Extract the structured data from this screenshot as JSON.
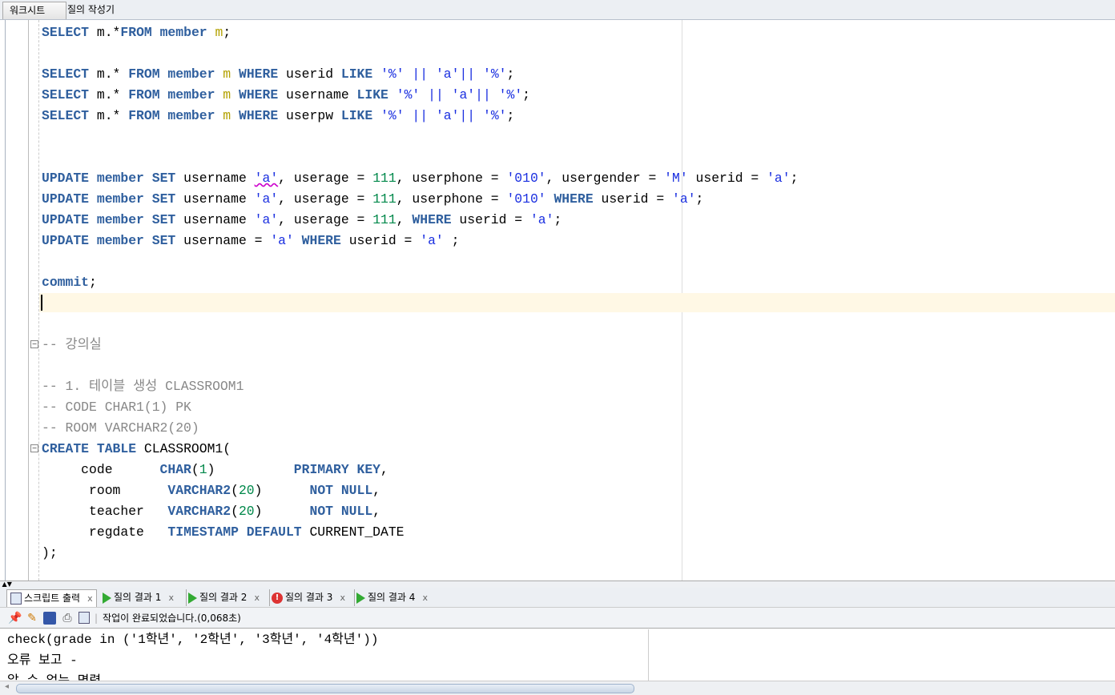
{
  "tabs": {
    "worksheet": "워크시트",
    "query_builder": "질의 작성기"
  },
  "editor": {
    "lines": [
      [
        [
          "SELECT",
          "kw"
        ],
        [
          " m.*",
          "tx"
        ],
        [
          "FROM",
          "kw"
        ],
        [
          " ",
          "tx"
        ],
        [
          "member",
          "kw"
        ],
        [
          " ",
          "tx"
        ],
        [
          "m",
          "al"
        ],
        [
          ";",
          "tx"
        ]
      ],
      [],
      [
        [
          "SELECT",
          "kw"
        ],
        [
          " m.* ",
          "tx"
        ],
        [
          "FROM",
          "kw"
        ],
        [
          " ",
          "tx"
        ],
        [
          "member",
          "kw"
        ],
        [
          " ",
          "tx"
        ],
        [
          "m",
          "al"
        ],
        [
          " ",
          "tx"
        ],
        [
          "WHERE",
          "kw"
        ],
        [
          " userid ",
          "tx"
        ],
        [
          "LIKE",
          "kw"
        ],
        [
          " ",
          "tx"
        ],
        [
          "'%'",
          "st"
        ],
        [
          " || ",
          "st"
        ],
        [
          "'a'",
          "st"
        ],
        [
          "|| ",
          "st"
        ],
        [
          "'%'",
          "st"
        ],
        [
          ";",
          "tx"
        ]
      ],
      [
        [
          "SELECT",
          "kw"
        ],
        [
          " m.* ",
          "tx"
        ],
        [
          "FROM",
          "kw"
        ],
        [
          " ",
          "tx"
        ],
        [
          "member",
          "kw"
        ],
        [
          " ",
          "tx"
        ],
        [
          "m",
          "al"
        ],
        [
          " ",
          "tx"
        ],
        [
          "WHERE",
          "kw"
        ],
        [
          " username ",
          "tx"
        ],
        [
          "LIKE",
          "kw"
        ],
        [
          " ",
          "tx"
        ],
        [
          "'%'",
          "st"
        ],
        [
          " || ",
          "st"
        ],
        [
          "'a'",
          "st"
        ],
        [
          "|| ",
          "st"
        ],
        [
          "'%'",
          "st"
        ],
        [
          ";",
          "tx"
        ]
      ],
      [
        [
          "SELECT",
          "kw"
        ],
        [
          " m.* ",
          "tx"
        ],
        [
          "FROM",
          "kw"
        ],
        [
          " ",
          "tx"
        ],
        [
          "member",
          "kw"
        ],
        [
          " ",
          "tx"
        ],
        [
          "m",
          "al"
        ],
        [
          " ",
          "tx"
        ],
        [
          "WHERE",
          "kw"
        ],
        [
          " userpw ",
          "tx"
        ],
        [
          "LIKE",
          "kw"
        ],
        [
          " ",
          "tx"
        ],
        [
          "'%'",
          "st"
        ],
        [
          " || ",
          "st"
        ],
        [
          "'a'",
          "st"
        ],
        [
          "|| ",
          "st"
        ],
        [
          "'%'",
          "st"
        ],
        [
          ";",
          "tx"
        ]
      ],
      [],
      [],
      [
        [
          "UPDATE",
          "kw"
        ],
        [
          " ",
          "tx"
        ],
        [
          "member",
          "kw"
        ],
        [
          " ",
          "tx"
        ],
        [
          "SET",
          "kw"
        ],
        [
          " username ",
          "tx"
        ],
        [
          "'a'",
          "st"
        ],
        [
          ", userage = ",
          "tx"
        ],
        [
          "111",
          "nu"
        ],
        [
          ", userphone = ",
          "tx"
        ],
        [
          "'010'",
          "st"
        ],
        [
          ", usergender = ",
          "tx"
        ],
        [
          "'M'",
          "st"
        ],
        [
          " userid = ",
          "tx"
        ],
        [
          "'a'",
          "st"
        ],
        [
          ";",
          "tx"
        ]
      ],
      [
        [
          "UPDATE",
          "kw"
        ],
        [
          " ",
          "tx"
        ],
        [
          "member",
          "kw"
        ],
        [
          " ",
          "tx"
        ],
        [
          "SET",
          "kw"
        ],
        [
          " username ",
          "tx"
        ],
        [
          "'a'",
          "st"
        ],
        [
          ", userage = ",
          "tx"
        ],
        [
          "111",
          "nu"
        ],
        [
          ", userphone = ",
          "tx"
        ],
        [
          "'010'",
          "st"
        ],
        [
          " ",
          "tx"
        ],
        [
          "WHERE",
          "kw"
        ],
        [
          " userid = ",
          "tx"
        ],
        [
          "'a'",
          "st"
        ],
        [
          ";",
          "tx"
        ]
      ],
      [
        [
          "UPDATE",
          "kw"
        ],
        [
          " ",
          "tx"
        ],
        [
          "member",
          "kw"
        ],
        [
          " ",
          "tx"
        ],
        [
          "SET",
          "kw"
        ],
        [
          " username ",
          "tx"
        ],
        [
          "'a'",
          "st"
        ],
        [
          ", userage = ",
          "tx"
        ],
        [
          "111",
          "nu"
        ],
        [
          ", ",
          "tx"
        ],
        [
          "WHERE",
          "kw"
        ],
        [
          " userid = ",
          "tx"
        ],
        [
          "'a'",
          "st"
        ],
        [
          ";",
          "tx"
        ]
      ],
      [
        [
          "UPDATE",
          "kw"
        ],
        [
          " ",
          "tx"
        ],
        [
          "member",
          "kw"
        ],
        [
          " ",
          "tx"
        ],
        [
          "SET",
          "kw"
        ],
        [
          " username = ",
          "tx"
        ],
        [
          "'a'",
          "st"
        ],
        [
          " ",
          "tx"
        ],
        [
          "WHERE",
          "kw"
        ],
        [
          " userid = ",
          "tx"
        ],
        [
          "'a'",
          "st"
        ],
        [
          " ;",
          "tx"
        ]
      ],
      [],
      [
        [
          "commit",
          "kw"
        ],
        [
          ";",
          "tx"
        ]
      ],
      [],
      [],
      [
        [
          "-- 강의실",
          "cm"
        ]
      ],
      [],
      [
        [
          "-- 1. 테이블 생성 CLASSROOM1",
          "cm"
        ]
      ],
      [
        [
          "-- CODE CHAR1(1) PK",
          "cm"
        ]
      ],
      [
        [
          "-- ROOM VARCHAR2(20)",
          "cm"
        ]
      ],
      [
        [
          "CREATE",
          "kw"
        ],
        [
          " ",
          "tx"
        ],
        [
          "TABLE",
          "kw"
        ],
        [
          " CLASSROOM1(",
          "tx"
        ]
      ],
      [
        [
          "     code      ",
          "tx"
        ],
        [
          "CHAR",
          "kw"
        ],
        [
          "(",
          "tx"
        ],
        [
          "1",
          "nu"
        ],
        [
          ")          ",
          "tx"
        ],
        [
          "PRIMARY",
          "kw"
        ],
        [
          " ",
          "tx"
        ],
        [
          "KEY",
          "kw"
        ],
        [
          ",",
          "tx"
        ]
      ],
      [
        [
          "      room      ",
          "tx"
        ],
        [
          "VARCHAR2",
          "kw"
        ],
        [
          "(",
          "tx"
        ],
        [
          "20",
          "nu"
        ],
        [
          ")      ",
          "tx"
        ],
        [
          "NOT",
          "kw"
        ],
        [
          " ",
          "tx"
        ],
        [
          "NULL",
          "kw"
        ],
        [
          ",",
          "tx"
        ]
      ],
      [
        [
          "      teacher   ",
          "tx"
        ],
        [
          "VARCHAR2",
          "kw"
        ],
        [
          "(",
          "tx"
        ],
        [
          "20",
          "nu"
        ],
        [
          ")      ",
          "tx"
        ],
        [
          "NOT",
          "kw"
        ],
        [
          " ",
          "tx"
        ],
        [
          "NULL",
          "kw"
        ],
        [
          ",",
          "tx"
        ]
      ],
      [
        [
          "      regdate   ",
          "tx"
        ],
        [
          "TIMESTAMP",
          "kw"
        ],
        [
          " ",
          "tx"
        ],
        [
          "DEFAULT",
          "kw"
        ],
        [
          " CURRENT_DATE",
          "tx"
        ]
      ],
      [
        [
          ");",
          "tx"
        ]
      ]
    ]
  },
  "results": {
    "tabs": [
      {
        "label": "스크립트 출력",
        "icon": "script-output-icon"
      },
      {
        "label": "질의 결과 1",
        "icon": "play-icon"
      },
      {
        "label": "질의 결과 2",
        "icon": "play-icon"
      },
      {
        "label": "질의 결과 3",
        "icon": "error-icon"
      },
      {
        "label": "질의 결과 4",
        "icon": "play-icon"
      }
    ],
    "close": "x",
    "status": "작업이 완료되었습니다.(0,068초)",
    "output": [
      "check(grade in ('1학년', '2학년', '3학년', '4학년'))",
      "오류 보고 -",
      "알 수 없는 명령"
    ]
  },
  "colors": {
    "keyword": "#2f5f9e",
    "string": "#1a2fe0",
    "number": "#00884a",
    "comment": "#888888",
    "current_line": "#fff8e5"
  }
}
